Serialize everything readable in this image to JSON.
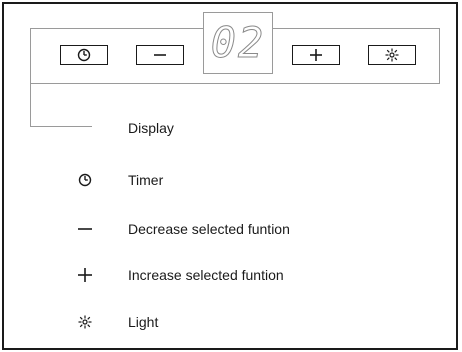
{
  "panel": {
    "display_value": "02",
    "buttons": [
      {
        "icon": "clock-icon"
      },
      {
        "icon": "minus-icon"
      },
      {
        "icon": "plus-icon"
      },
      {
        "icon": "light-icon"
      }
    ]
  },
  "legend": {
    "display_label": "Display",
    "items": [
      {
        "icon": "clock-icon",
        "label": "Timer"
      },
      {
        "icon": "minus-icon",
        "label": "Decrease selected funtion"
      },
      {
        "icon": "plus-icon",
        "label": "Increase selected funtion"
      },
      {
        "icon": "light-icon",
        "label": "Light"
      }
    ]
  },
  "colors": {
    "stroke": "#1a1a1a",
    "leader": "#9a9a9a",
    "display_segment": "#8a8a8a"
  }
}
